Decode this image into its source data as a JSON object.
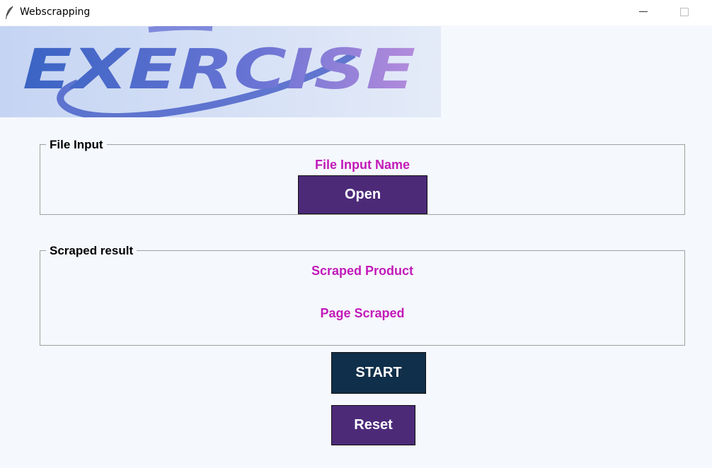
{
  "window": {
    "title": "Webscrapping"
  },
  "banner": {
    "logo_text": "EXERCISE",
    "colors": {
      "start": "#3a64c4",
      "mid": "#5a6fd0",
      "end": "#b48bdc",
      "background": "#cfdcf5"
    }
  },
  "file_input": {
    "legend": "File Input",
    "file_name_label": "File Input Name",
    "open_button": "Open"
  },
  "scraped_result": {
    "legend": "Scraped result",
    "product_label": "Scraped Product",
    "page_label": "Page Scraped"
  },
  "actions": {
    "start_button": "START",
    "reset_button": "Reset"
  },
  "colors": {
    "accent_magenta": "#c21ab8",
    "button_purple": "#4c2a78",
    "button_navy": "#102f4a",
    "background": "#f5f8fd"
  }
}
